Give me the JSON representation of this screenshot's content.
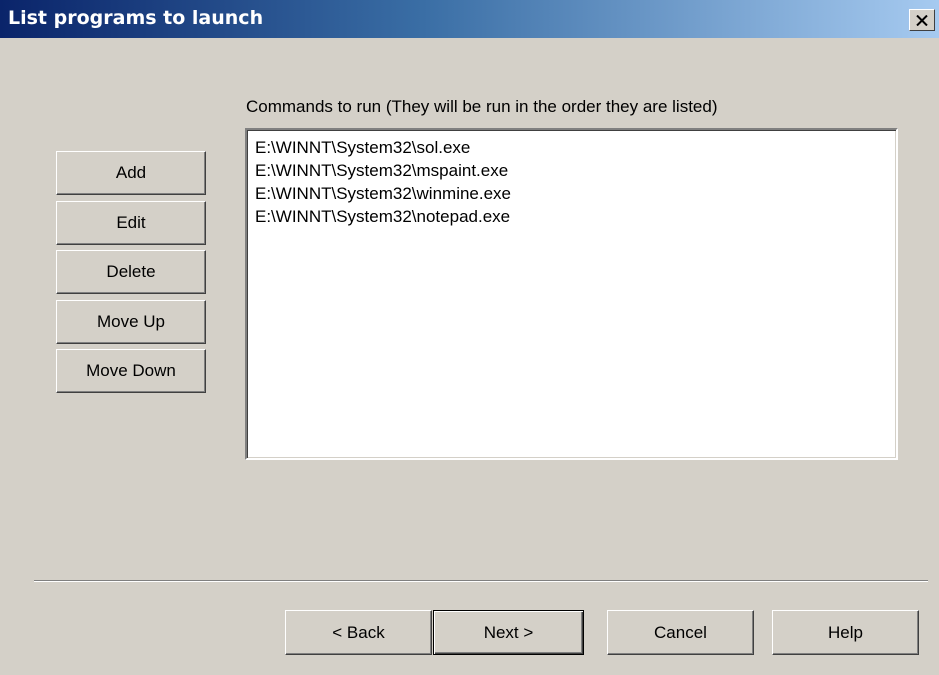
{
  "window": {
    "title": "List programs to launch",
    "close_label": "X"
  },
  "commands": {
    "caption": "Commands to run (They will be run in the order they are listed)",
    "items": [
      "E:\\WINNT\\System32\\sol.exe",
      "E:\\WINNT\\System32\\mspaint.exe",
      "E:\\WINNT\\System32\\winmine.exe",
      "E:\\WINNT\\System32\\notepad.exe"
    ]
  },
  "side_buttons": {
    "add": "Add",
    "edit": "Edit",
    "delete": "Delete",
    "move_up": "Move Up",
    "move_down": "Move Down"
  },
  "nav_buttons": {
    "back": "< Back",
    "next": "Next >",
    "cancel": "Cancel",
    "help": "Help"
  }
}
